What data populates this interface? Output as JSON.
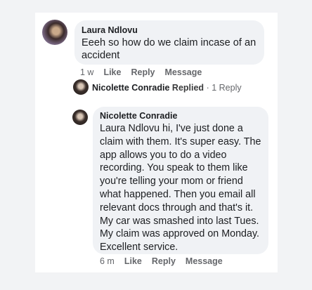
{
  "comment1": {
    "author": "Laura Ndlovu",
    "text": "Eeeh so how do we claim incase of an accident",
    "time": "1 w",
    "like_label": "Like",
    "reply_label": "Reply",
    "message_label": "Message"
  },
  "reply_summary": {
    "author": "Nicolette Conradie",
    "verb": "Replied",
    "separator": "·",
    "count_label": "1 Reply"
  },
  "comment2": {
    "author": "Nicolette Conradie",
    "text": "Laura Ndlovu hi, I've just done a claim with them. It's super easy. The app allows you to do a video recording. You speak to them like you're telling your mom or friend what happened. Then you email all relevant docs through and that's it. My car was smashed into last Tues. My claim was approved on Monday. Excellent service.",
    "time": "6 m",
    "like_label": "Like",
    "reply_label": "Reply",
    "message_label": "Message"
  }
}
